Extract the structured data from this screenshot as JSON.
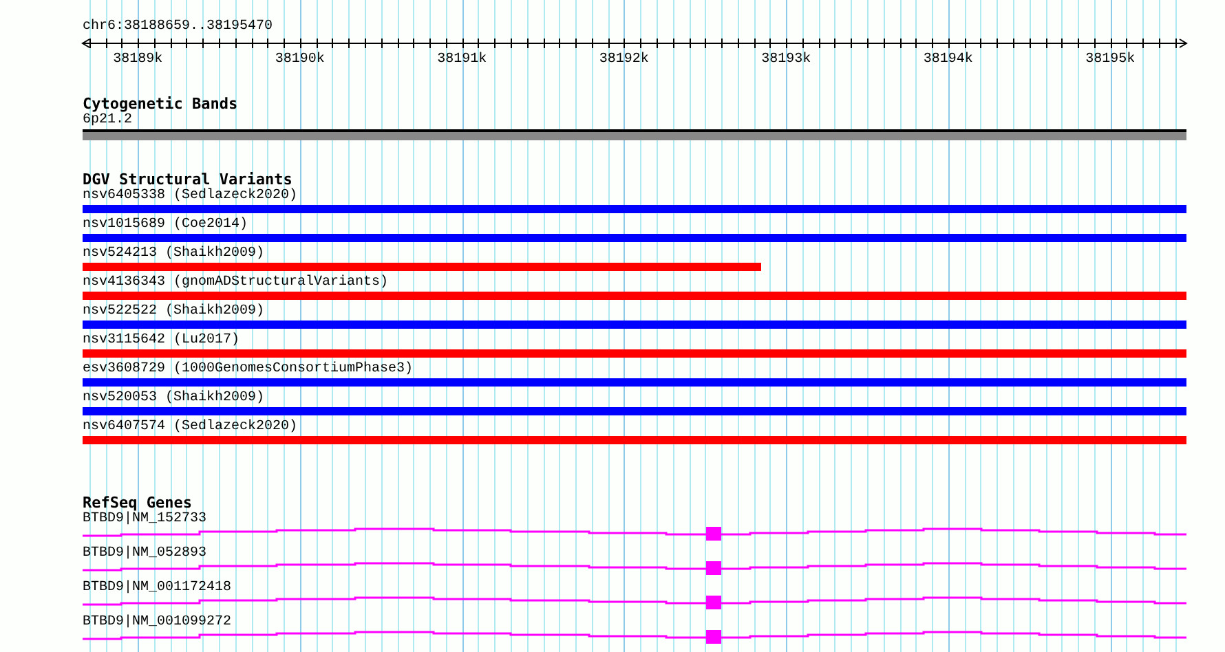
{
  "ruler": {
    "location": "chr6:38188659..38195470",
    "ticks": [
      "38189k",
      "38190k",
      "38191k",
      "38192k",
      "38193k",
      "38194k",
      "38195k"
    ]
  },
  "tracks": [
    {
      "kind": "bands",
      "title": "Cytogenetic Bands",
      "features": [
        {
          "label": "6p21.2"
        }
      ]
    },
    {
      "kind": "variants",
      "title": "DGV Structural Variants",
      "features": [
        {
          "label": "nsv6405338 (Sedlazeck2020)",
          "color": "#0000ff",
          "spans_view": true
        },
        {
          "label": "nsv1015689 (Coe2014)",
          "color": "#0000ff",
          "spans_view": true
        },
        {
          "label": "nsv524213 (Shaikh2009)",
          "color": "#ff0000",
          "spans_view": false
        },
        {
          "label": "nsv4136343 (gnomADStructuralVariants)",
          "color": "#ff0000",
          "spans_view": true
        },
        {
          "label": "nsv522522 (Shaikh2009)",
          "color": "#0000ff",
          "spans_view": true
        },
        {
          "label": "nsv3115642 (Lu2017)",
          "color": "#ff0000",
          "spans_view": true
        },
        {
          "label": "esv3608729 (1000GenomesConsortiumPhase3)",
          "color": "#0000ff",
          "spans_view": true
        },
        {
          "label": "nsv520053 (Shaikh2009)",
          "color": "#0000ff",
          "spans_view": true
        },
        {
          "label": "nsv6407574 (Sedlazeck2020)",
          "color": "#ff0000",
          "spans_view": true
        }
      ]
    },
    {
      "kind": "genes",
      "title": "RefSeq Genes",
      "features": [
        {
          "label": "BTBD9|NM_152733"
        },
        {
          "label": "BTBD9|NM_052893"
        },
        {
          "label": "BTBD9|NM_001172418"
        },
        {
          "label": "BTBD9|NM_001099272"
        }
      ]
    }
  ]
}
